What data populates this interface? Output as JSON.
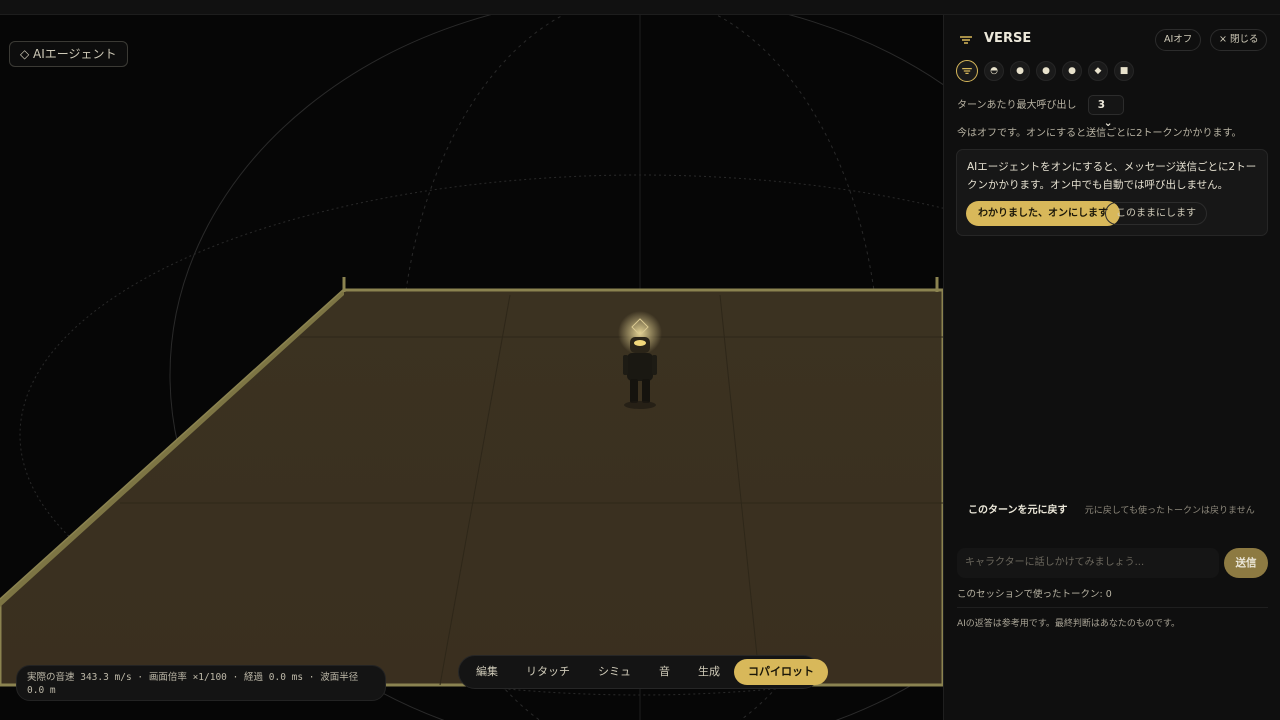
{
  "viewport": {
    "ai_agent_button": {
      "icon": "diamond-icon",
      "label": "◇ AIエージェント"
    },
    "hud": {
      "text": "実際の音速 343.3 m/s · 画面倍率 ×1/100 · 経過 0.0 ms · 波面半径 0.0 m"
    },
    "toolbar": {
      "items": [
        {
          "label": "編集"
        },
        {
          "label": "リタッチ"
        },
        {
          "label": "シミュ"
        },
        {
          "label": "音"
        },
        {
          "label": "生成"
        },
        {
          "label": "コパイロット",
          "active": true
        }
      ]
    },
    "colors": {
      "floor": "#3a3020",
      "floor_edge": "#8b8350",
      "accent": "#d8b85a"
    }
  },
  "sidebar": {
    "brand_icon": "verse-logo-icon",
    "title": "VERSE",
    "ai_off_label": "AIオフ",
    "close_label": "× 閉じる",
    "avatars": [
      {
        "icon": "verse-logo-icon",
        "selected": true
      },
      {
        "icon": "ghost-icon"
      },
      {
        "icon": "face-icon"
      },
      {
        "icon": "face-icon"
      },
      {
        "icon": "face-icon"
      },
      {
        "icon": "face-icon"
      },
      {
        "icon": "robot-icon"
      }
    ],
    "max_calls_label": "ターンあたり最大呼び出し",
    "max_calls_value": "3",
    "status_text": "今はオフです。オンにすると送信ごとに2トークンかかります。",
    "confirm_card": {
      "text": "AIエージェントをオンにすると、メッセージ送信ごとに2トークンかかります。オン中でも自動では呼び出しません。",
      "primary_label": "わかりました、オンにします",
      "secondary_label": "このままにします"
    },
    "undo_label": "このターンを元に戻す",
    "undo_note": "元に戻しても使ったトークンは戻りません",
    "input_placeholder": "キャラクターに話しかけてみましょう...",
    "send_label": "送信",
    "tokens_text": "このセッションで使ったトークン: 0",
    "disclaimer": "AIの返答は参考用です。最終判断はあなたのものです。"
  }
}
